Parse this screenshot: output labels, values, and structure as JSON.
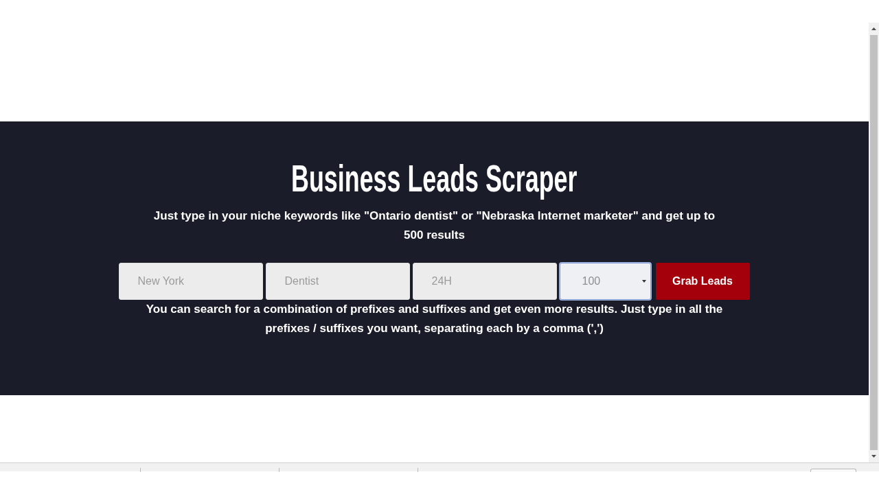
{
  "hero": {
    "title": "Business Leads Scraper",
    "subtitle": "Just type in your niche keywords like \"Ontario dentist\" or \"Nebraska Internet marketer\" and get up to 500 results"
  },
  "search_form": {
    "fields": [
      {
        "placeholder": "New York"
      },
      {
        "placeholder": "Dentist"
      },
      {
        "placeholder": "24H"
      }
    ],
    "results_select": {
      "value": "100",
      "focused": true
    },
    "button": "Grab Leads"
  },
  "help_text": "You can search for a combination of prefixes and suffixes and get even more results. Just type in all the prefixes / suffixes you want, separating each by a comma (',')"
}
